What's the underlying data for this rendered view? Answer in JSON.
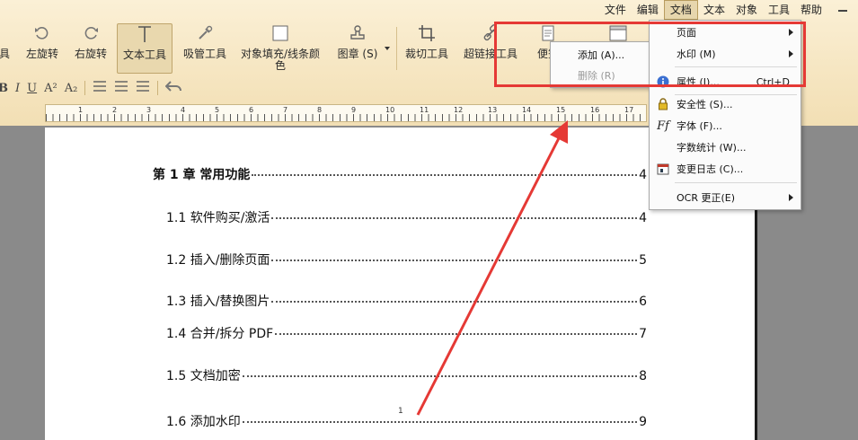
{
  "menubar": {
    "items": [
      "文件",
      "编辑",
      "文档",
      "文本",
      "对象",
      "工具",
      "帮助"
    ],
    "active_index": 2
  },
  "toolbar": {
    "tools": [
      {
        "label": "具",
        "icon": "hand-icon"
      },
      {
        "label": "左旋转",
        "icon": "rotate-left-icon"
      },
      {
        "label": "右旋转",
        "icon": "rotate-right-icon"
      },
      {
        "label": "文本工具",
        "icon": "text-tool-icon"
      },
      {
        "label": "吸管工具",
        "icon": "eyedropper-icon"
      },
      {
        "label": "对象填充/线条颜\n色",
        "icon": "fill-color-icon"
      },
      {
        "label": "图章 (S)",
        "icon": "stamp-icon"
      },
      {
        "label": "裁切工具",
        "icon": "crop-icon"
      },
      {
        "label": "超链接工具",
        "icon": "link-icon"
      },
      {
        "label": "便签",
        "icon": "note-icon"
      }
    ],
    "selected_index": 3
  },
  "formatbar": {
    "bold": "B",
    "italic": "I",
    "underline": "U",
    "superscript": "A²",
    "subscript": "A₂"
  },
  "ruler": {
    "numbers": [
      "1",
      "2",
      "3",
      "4",
      "5",
      "6",
      "7",
      "8",
      "9",
      "10",
      "11",
      "12",
      "13",
      "14",
      "15",
      "16",
      "17"
    ]
  },
  "toc": {
    "entries": [
      {
        "title": "第 1 章  常用功能",
        "page": "4",
        "chapter": true
      },
      {
        "title": "1.1 软件购买/激活",
        "page": "4",
        "chapter": false
      },
      {
        "title": "1.2 插入/删除页面",
        "page": "5",
        "chapter": false
      },
      {
        "title": "1.3 插入/替换图片",
        "page": "6",
        "chapter": false
      },
      {
        "title": "1.4 合并/拆分 PDF",
        "page": "7",
        "chapter": false
      },
      {
        "title": "1.5 文档加密",
        "page": "8",
        "chapter": false
      },
      {
        "title": "1.6 添加水印",
        "page": "9",
        "chapter": false
      }
    ],
    "page_marker": "1"
  },
  "document_menu": {
    "items": [
      {
        "label": "页面",
        "submenu": true,
        "icon": ""
      },
      {
        "label": "水印 (M)",
        "submenu": true,
        "icon": ""
      },
      {
        "label": "属性 (I)...",
        "shortcut": "Ctrl+D",
        "icon": "info-icon"
      },
      {
        "label": "安全性 (S)...",
        "icon": "lock-icon"
      },
      {
        "label": "字体 (F)...",
        "icon": "font-icon"
      },
      {
        "label": "字数统计 (W)...",
        "icon": ""
      },
      {
        "label": "变更日志 (C)...",
        "icon": "changelog-icon"
      },
      {
        "label": "OCR 更正(E)",
        "submenu": true,
        "icon": ""
      }
    ]
  },
  "watermark_submenu": {
    "items": [
      {
        "label": "添加 (A)...",
        "disabled": false
      },
      {
        "label": "删除 (R)",
        "disabled": true
      }
    ]
  },
  "colors": {
    "highlight": "#e53935",
    "toolbar_bg": "#f6e6c2"
  }
}
